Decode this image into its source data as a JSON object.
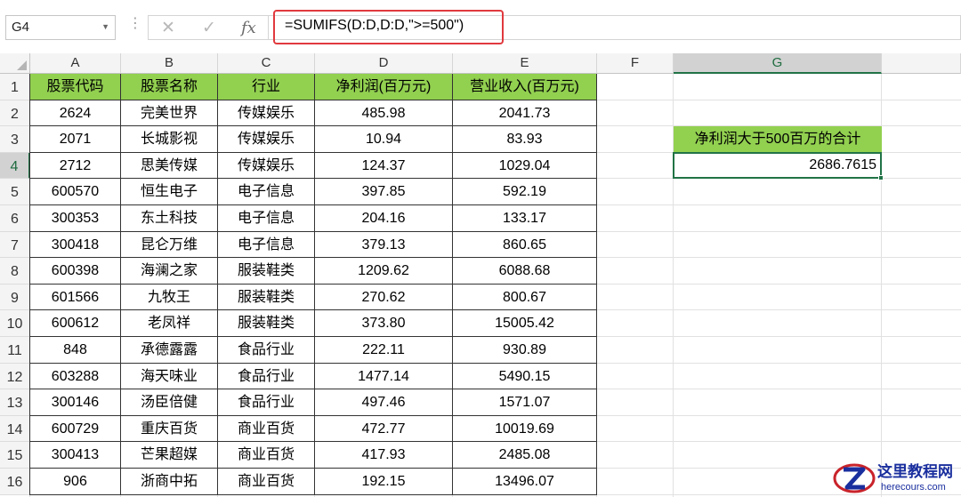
{
  "formula_bar": {
    "name_box": "G4",
    "dropdown_icon": "chevron-down-icon",
    "more_icon": "vertical-dots-icon",
    "cancel_icon": "close-icon",
    "confirm_icon": "checkmark-icon",
    "fx_label": "fx",
    "formula": "=SUMIFS(D:D,D:D,\">=500\")",
    "highlight_color": "#e0393e"
  },
  "columns": [
    "A",
    "B",
    "C",
    "D",
    "E",
    "F",
    "G"
  ],
  "selected_column": "G",
  "row_numbers": [
    "1",
    "2",
    "3",
    "4",
    "5",
    "6",
    "7",
    "8",
    "9",
    "10",
    "11",
    "12",
    "13",
    "14",
    "15",
    "16"
  ],
  "selected_row": "4",
  "table": {
    "header_color": "#92d050",
    "headers": [
      "股票代码",
      "股票名称",
      "行业",
      "净利润(百万元)",
      "营业收入(百万元)"
    ],
    "rows": [
      [
        "2624",
        "完美世界",
        "传媒娱乐",
        "485.98",
        "2041.73"
      ],
      [
        "2071",
        "长城影视",
        "传媒娱乐",
        "10.94",
        "83.93"
      ],
      [
        "2712",
        "思美传媒",
        "传媒娱乐",
        "124.37",
        "1029.04"
      ],
      [
        "600570",
        "恒生电子",
        "电子信息",
        "397.85",
        "592.19"
      ],
      [
        "300353",
        "东土科技",
        "电子信息",
        "204.16",
        "133.17"
      ],
      [
        "300418",
        "昆仑万维",
        "电子信息",
        "379.13",
        "860.65"
      ],
      [
        "600398",
        "海澜之家",
        "服装鞋类",
        "1209.62",
        "6088.68"
      ],
      [
        "601566",
        "九牧王",
        "服装鞋类",
        "270.62",
        "800.67"
      ],
      [
        "600612",
        "老凤祥",
        "服装鞋类",
        "373.80",
        "15005.42"
      ],
      [
        "848",
        "承德露露",
        "食品行业",
        "222.11",
        "930.89"
      ],
      [
        "603288",
        "海天味业",
        "食品行业",
        "1477.14",
        "5490.15"
      ],
      [
        "300146",
        "汤臣倍健",
        "食品行业",
        "497.46",
        "1571.07"
      ],
      [
        "600729",
        "重庆百货",
        "商业百货",
        "472.77",
        "10019.69"
      ],
      [
        "300413",
        "芒果超媒",
        "商业百货",
        "417.93",
        "2485.08"
      ],
      [
        "906",
        "浙商中拓",
        "商业百货",
        "192.15",
        "13496.07"
      ]
    ]
  },
  "result": {
    "label": "净利润大于500百万的合计",
    "value": "2686.7615",
    "selection_color": "#217346"
  },
  "watermark": {
    "logo_icon": "z-logo-icon",
    "title": "这里教程网",
    "url": "herecours.com"
  }
}
